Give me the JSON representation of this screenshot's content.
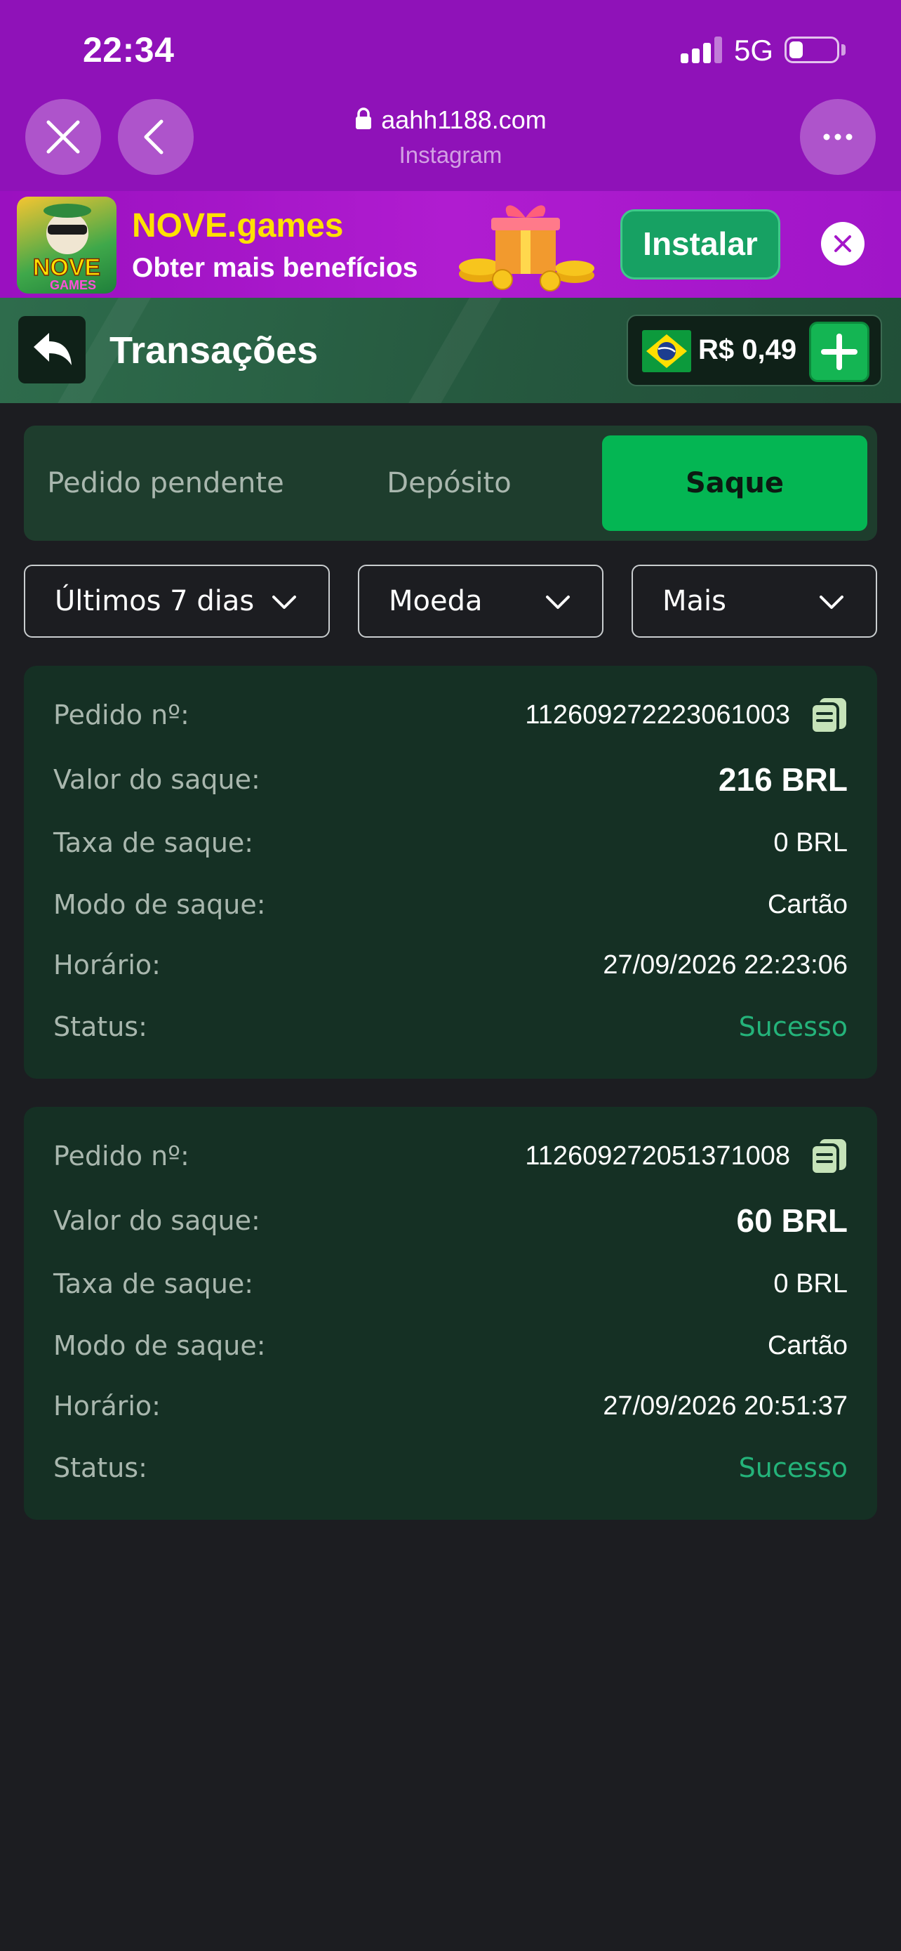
{
  "status_bar": {
    "time": "22:34",
    "network": "5G",
    "battery_level": 0.3
  },
  "browser": {
    "url": "aahh1188.com",
    "source": "Instagram",
    "icons": [
      "close-icon",
      "chevron-left-icon",
      "more-icon",
      "lock-icon"
    ]
  },
  "banner": {
    "logo_text": "NOVE GAMES",
    "title": "NOVE.games",
    "subtitle": "Obter mais benefícios",
    "install_label": "Instalar",
    "colors": {
      "title": "#ffe100",
      "install_bg": "#17a163",
      "background": "#9a10c0"
    }
  },
  "header": {
    "title": "Transações",
    "balance": "R$ 0,49",
    "currency_flag": "brazil-flag-icon",
    "colors": {
      "background": "#2e6c4c",
      "add_button": "#14b553"
    }
  },
  "tabs": [
    {
      "label": "Pedido pendente",
      "active": false
    },
    {
      "label": "Depósito",
      "active": false
    },
    {
      "label": "Saque",
      "active": true
    }
  ],
  "filters": [
    {
      "label": "Últimos 7 dias"
    },
    {
      "label": "Moeda"
    },
    {
      "label": "Mais"
    }
  ],
  "labels": {
    "order": "Pedido nº:",
    "amount": "Valor do saque:",
    "fee": "Taxa de saque:",
    "mode": "Modo de saque:",
    "time": "Horário:",
    "status": "Status:"
  },
  "transactions": [
    {
      "order_no": "112609272223061003",
      "amount": "216 BRL",
      "fee": "0 BRL",
      "mode": "Cartão",
      "time": "27/09/2026 22:23:06",
      "status": "Sucesso"
    },
    {
      "order_no": "112609272051371008",
      "amount": "60 BRL",
      "fee": "0 BRL",
      "mode": "Cartão",
      "time": "27/09/2026 20:51:37",
      "status": "Sucesso"
    }
  ],
  "colors": {
    "page_bg": "#1c1d21",
    "card_bg": "#153024",
    "success": "#24b37a",
    "active_tab": "#04b653"
  }
}
